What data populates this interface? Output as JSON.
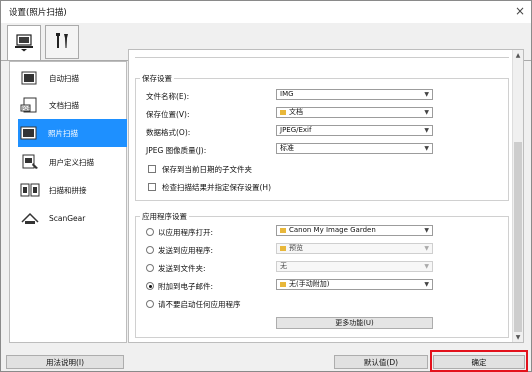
{
  "window": {
    "title": "设置(照片扫描)",
    "close_glyph": "×"
  },
  "tabs": [
    {
      "name": "scan-from-computer",
      "icon": "computer-scan-icon"
    },
    {
      "name": "general-settings",
      "icon": "tools-icon"
    }
  ],
  "sidebar": {
    "items": [
      {
        "label": "自动扫描",
        "icon": "auto-scan-icon",
        "active": false
      },
      {
        "label": "文档扫描",
        "icon": "document-scan-icon",
        "active": false
      },
      {
        "label": "照片扫描",
        "icon": "photo-scan-icon",
        "active": true
      },
      {
        "label": "用户定义扫描",
        "icon": "custom-scan-icon",
        "active": false
      },
      {
        "label": "扫描和拼接",
        "icon": "scan-stitch-icon",
        "active": false
      },
      {
        "label": "ScanGear",
        "icon": "scangear-icon",
        "active": false
      }
    ]
  },
  "save_settings": {
    "title": "保存设置",
    "file_name_label": "文件名称(E):",
    "file_name_value": "IMG",
    "save_in_label": "保存位置(V):",
    "save_in_value": "文档",
    "data_format_label": "数据格式(O):",
    "data_format_value": "JPEG/Exif",
    "jpeg_quality_label": "JPEG 图像质量(J):",
    "jpeg_quality_value": "标准",
    "subfolder_label": "保存到当前日期的子文件夹",
    "check_results_label": "检查扫描结果并指定保存设置(H)"
  },
  "app_settings": {
    "title": "应用程序设置",
    "open_with_label": "以应用程序打开:",
    "open_with_value": "Canon My Image Garden",
    "send_to_app_label": "发送到应用程序:",
    "send_to_app_value": "预览",
    "send_to_folder_label": "发送到文件夹:",
    "send_to_folder_value": "无",
    "attach_email_label": "附加到电子邮件:",
    "attach_email_value": "无(手动附加)",
    "none_label": "请不要启动任何应用程序",
    "more_functions": "更多功能(U)",
    "selected_option": "附加到电子邮件:"
  },
  "footer": {
    "help": "用法说明(I)",
    "defaults": "默认值(D)",
    "ok": "确定"
  },
  "colors": {
    "selection": "#1e90ff",
    "highlight": "#e3111b"
  }
}
